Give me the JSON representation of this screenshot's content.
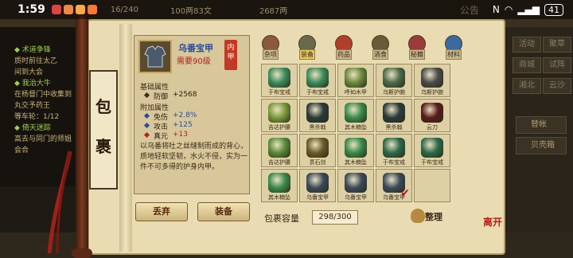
{
  "status_bar": {
    "time": "1:59",
    "background_hint": "16/240",
    "background_hint_2": "100两83文",
    "background_hint_3": "2687两",
    "notice": "公告",
    "battery": "41"
  },
  "quest_log": [
    {
      "title": "◆ 术道争锋",
      "desc": "质时前往太乙"
    },
    {
      "title": "",
      "desc": "间到大会"
    },
    {
      "title": "◆ 我治大牛",
      "desc": "在杨督门中收集到"
    },
    {
      "title": "",
      "desc": "丸交予药王"
    },
    {
      "title": "",
      "desc": "等车轮：1/12"
    },
    {
      "title": "◆ 倚天迷踪",
      "desc": "高去与同门的师姐"
    },
    {
      "title": "",
      "desc": "会合"
    }
  ],
  "right_menu": [
    "活动",
    "聚草",
    "商城",
    "试阵",
    "湘北",
    "云沙"
  ],
  "side_buttons": [
    "替帐",
    "贝壳箱"
  ],
  "window": {
    "title_chars": [
      "包",
      "裹"
    ],
    "leave_label": "离开"
  },
  "detail": {
    "item_name": "乌番宝甲",
    "level_req": "需要90级",
    "seal_text": "内甲",
    "base_title": "基础属性",
    "base_stats": [
      {
        "name": "防御",
        "value": "+2568"
      }
    ],
    "extra_title": "附加属性",
    "extra_stats": [
      {
        "name": "免伤",
        "value": "+2.8%"
      },
      {
        "name": "攻击",
        "value": "+125"
      },
      {
        "name": "真元",
        "value": "+13"
      }
    ],
    "description": "以乌番将吐之丝缝制而成的背心，质地轻软坚韧，水火不侵，实为一件不可多得的护身内甲。",
    "discard_label": "丢弃",
    "equip_label": "装备"
  },
  "categories": [
    {
      "label": "杂项",
      "color": "#8a5a3a"
    },
    {
      "label": "装备",
      "color": "#6a6a4a",
      "active": true
    },
    {
      "label": "药品",
      "color": "#b0402a"
    },
    {
      "label": "酒食",
      "color": "#6a5a3a"
    },
    {
      "label": "秘籍",
      "color": "#9a3a3a"
    },
    {
      "label": "材料",
      "color": "#3a6aa0"
    }
  ],
  "inventory": [
    {
      "label": "于布宝戒",
      "color": "#3a8a5a"
    },
    {
      "label": "于布宝戒",
      "color": "#3a8a5a"
    },
    {
      "label": "呼如木甲",
      "color": "#6a8a3a"
    },
    {
      "label": "乌斯护腕",
      "color": "#4a6a4a"
    },
    {
      "label": "乌斯护腕",
      "color": "#4a4a4a"
    },
    {
      "label": "吉达护腰",
      "color": "#7a9a3a"
    },
    {
      "label": "黑杀戟",
      "color": "#2a3a3a"
    },
    {
      "label": "其木楠坠",
      "color": "#3a8a4a"
    },
    {
      "label": "黑杀戟",
      "color": "#2a3a3a"
    },
    {
      "label": "云刀",
      "color": "#5a1a1a"
    },
    {
      "label": "吉达护腰",
      "color": "#5a8a3a"
    },
    {
      "label": "贯石剑",
      "color": "#6a5a2a"
    },
    {
      "label": "其木楠坠",
      "color": "#3a8a4a"
    },
    {
      "label": "于布宝戒",
      "color": "#2a6a4a"
    },
    {
      "label": "于布宝戒",
      "color": "#2a6a4a"
    },
    {
      "label": "其木楠坠",
      "color": "#3a8a4a"
    },
    {
      "label": "乌番宝甲",
      "color": "#3a4a5a"
    },
    {
      "label": "乌番宝甲",
      "color": "#3a4a5a"
    },
    {
      "label": "乌番宝甲",
      "color": "#3a4a5a",
      "checked": true
    }
  ],
  "capacity": {
    "label": "包裹容量",
    "value": "298/300",
    "sort_label": "整理"
  }
}
